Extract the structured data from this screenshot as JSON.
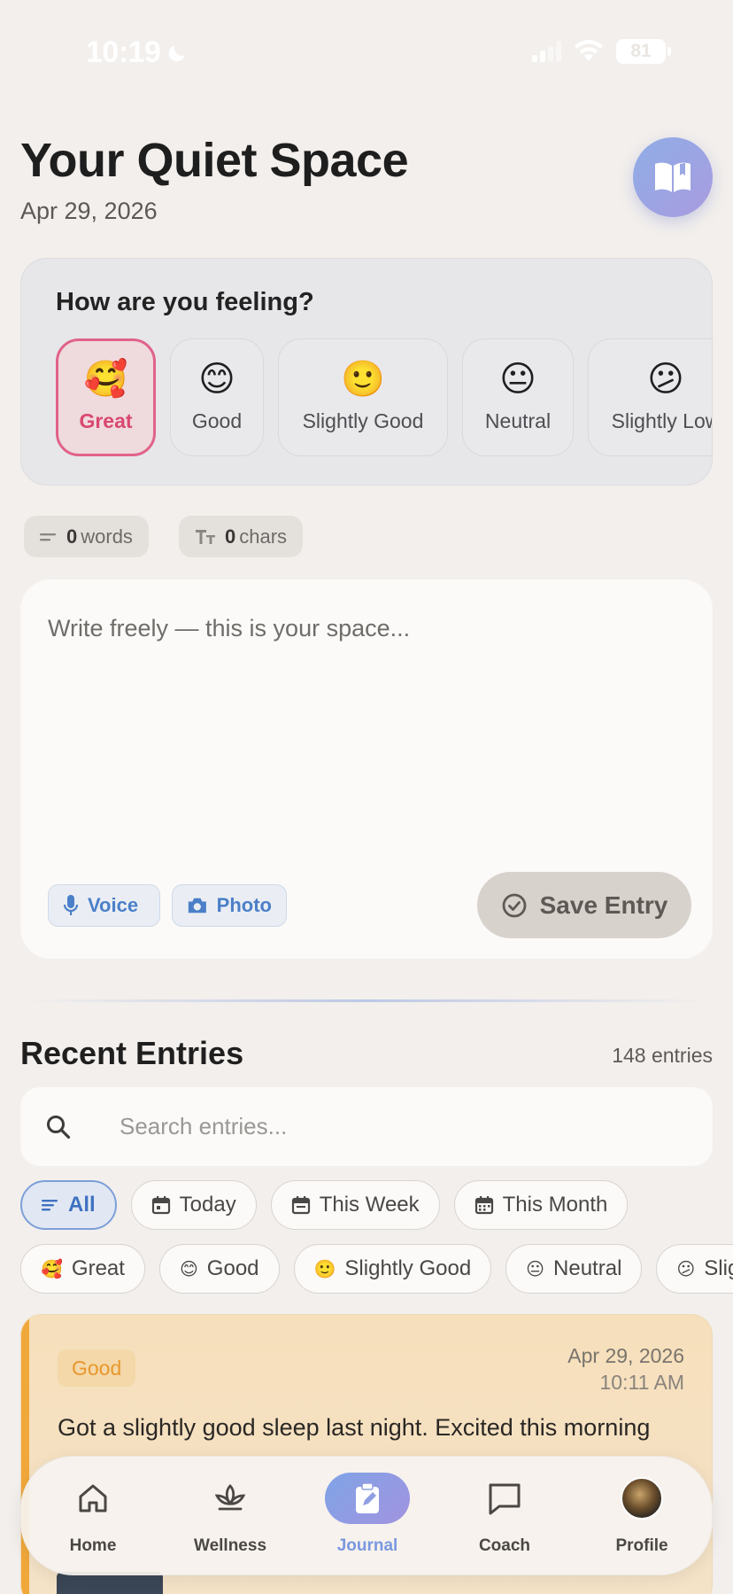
{
  "status_bar": {
    "time": "10:19",
    "battery": "81"
  },
  "header": {
    "title": "Your Quiet Space",
    "date": "Apr 29, 2026"
  },
  "mood": {
    "question": "How are you feeling?",
    "options": [
      {
        "emoji": "🥰",
        "label": "Great",
        "selected": true
      },
      {
        "emoji": "😊",
        "label": "Good"
      },
      {
        "emoji": "🙂",
        "label": "Slightly Good"
      },
      {
        "emoji": "😐",
        "label": "Neutral"
      },
      {
        "emoji": "😕",
        "label": "Slightly Low"
      }
    ]
  },
  "counts": {
    "words_value": "0",
    "words_label": "words",
    "chars_value": "0",
    "chars_label": "chars"
  },
  "editor": {
    "placeholder": "Write freely — this is your space...",
    "voice_label": "Voice",
    "photo_label": "Photo",
    "save_label": "Save Entry"
  },
  "recent": {
    "title": "Recent Entries",
    "count": "148 entries",
    "search_placeholder": "Search entries...",
    "time_filters": [
      "All",
      "Today",
      "This Week",
      "This Month"
    ],
    "mood_filters": [
      {
        "emoji": "🥰",
        "label": "Great"
      },
      {
        "emoji": "😊",
        "label": "Good"
      },
      {
        "emoji": "🙂",
        "label": "Slightly Good"
      },
      {
        "emoji": "😐",
        "label": "Neutral"
      },
      {
        "emoji": "😕",
        "label": "Slightly Low"
      }
    ],
    "entry": {
      "mood": "Good",
      "date": "Apr 29, 2026",
      "time": "10:11 AM",
      "text": "Got a slightly good sleep last night. Excited this morning"
    }
  },
  "nav": {
    "items": [
      {
        "label": "Home",
        "icon": "home-icon"
      },
      {
        "label": "Wellness",
        "icon": "lotus-icon"
      },
      {
        "label": "Journal",
        "icon": "journal-edit-icon",
        "active": true
      },
      {
        "label": "Coach",
        "icon": "chat-icon"
      },
      {
        "label": "Profile",
        "icon": "avatar"
      }
    ]
  },
  "colors": {
    "accent": "#7fa4e6",
    "selected_mood": "#e0628a",
    "entry_good": "#f1a83b",
    "background": "#f2efec"
  }
}
